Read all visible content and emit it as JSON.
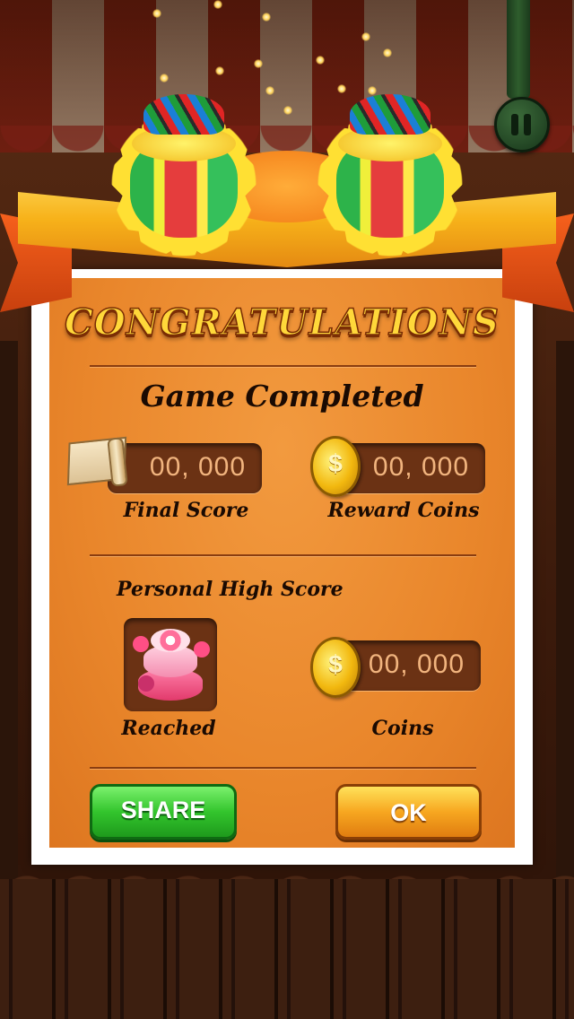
{
  "title": "CONGRATULATIONS",
  "subtitle": "Game Completed",
  "final_score": {
    "value": "00, 000",
    "label": "Final Score"
  },
  "reward_coins": {
    "value": "00, 000",
    "label": "Reward Coins"
  },
  "high_score": {
    "heading": "Personal High Score",
    "reached_label": "Reached",
    "coins_value": "00, 000",
    "coins_label": "Coins"
  },
  "buttons": {
    "share": "SHARE",
    "ok": "OK"
  },
  "icons": {
    "coin_symbol": "$",
    "pause": "pause-icon",
    "trophy": "confetti-trophy-icon",
    "scroll": "scroll-icon",
    "cake": "cake-icon"
  },
  "colors": {
    "panel": "#e9862b",
    "title_fill": "#ffd83a",
    "share_button": "#33c52d",
    "ok_button": "#f7a720"
  }
}
